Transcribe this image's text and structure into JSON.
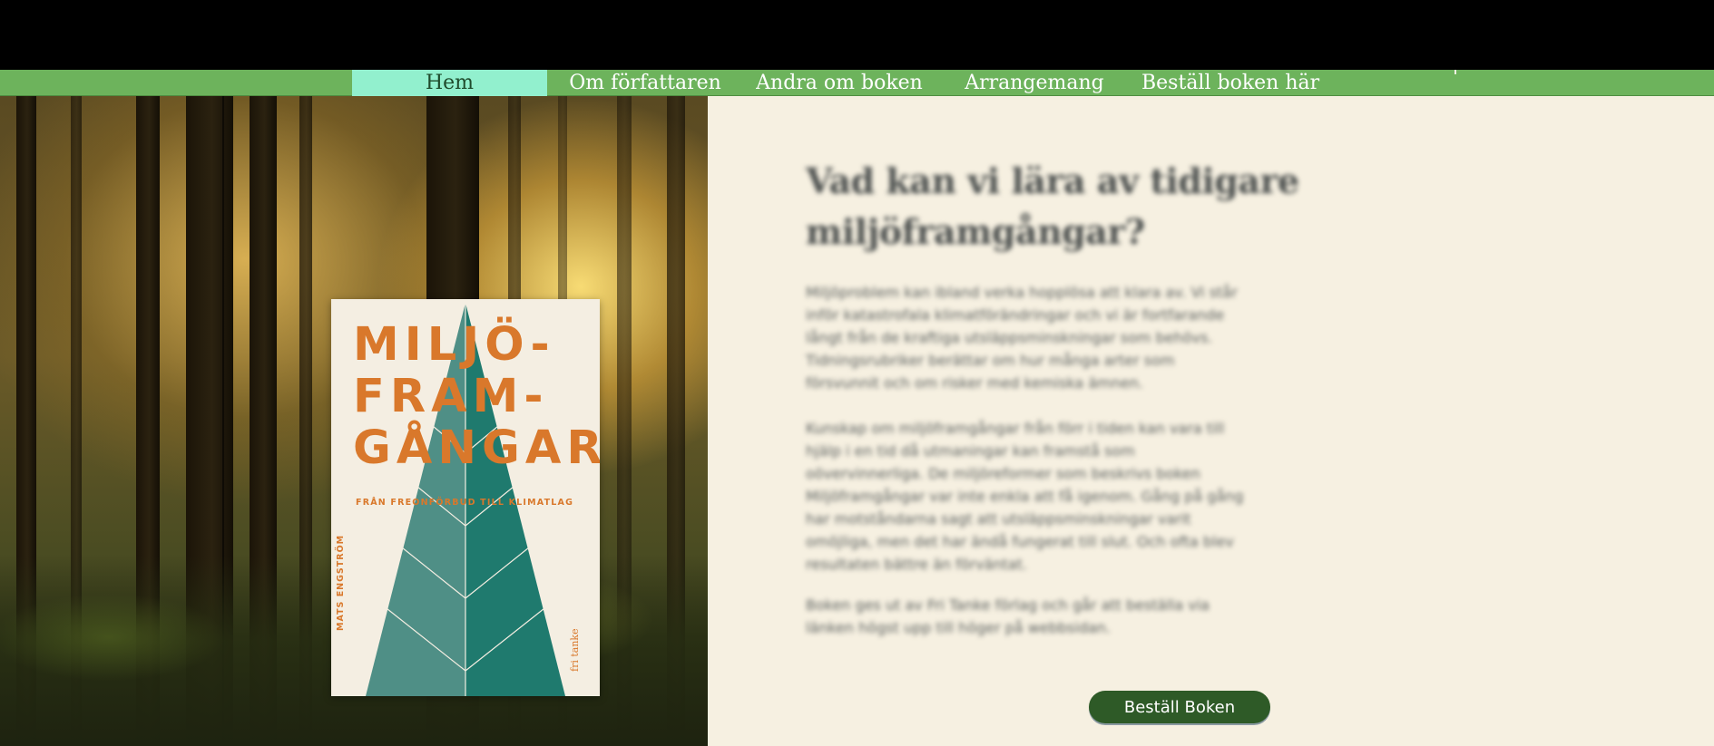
{
  "nav": {
    "items": [
      {
        "label": "Hem",
        "active": true
      },
      {
        "label": "Om författaren",
        "active": false
      },
      {
        "label": "Andra om boken",
        "active": false
      },
      {
        "label": "Arrangemang",
        "active": false
      },
      {
        "label": "Beställ boken här",
        "active": false
      }
    ]
  },
  "book": {
    "title_lines": [
      "MILJÖ-",
      "FRAM-",
      "GÅNGAR"
    ],
    "subtitle": "FRÅN FREONFÖRBUD TILL KLIMATLAG",
    "author": "MATS ENGSTRÖM",
    "publisher": "fri tanke"
  },
  "main": {
    "heading": "Vad kan vi lära av tidigare miljöframgångar?",
    "paragraphs": [
      "Miljöproblem kan ibland verka hopplösa att klara av. Vi står inför katastrofala klimatförändringar och vi är fortfarande långt från de kraftiga utsläppsminskningar som behövs. Tidningsrubriker berättar om hur många arter som försvunnit och om risker med kemiska ämnen.",
      "Kunskap om miljöframgångar från förr i tiden kan vara till hjälp i en tid då utmaningar kan framstå som oövervinnerliga. De miljöreformer som beskrivs boken Miljöframgångar var inte enkla att få igenom. Gång på gång har motståndarna sagt att utsläppsminskningar varit omöjliga, men det har ändå fungerat till slut. Och ofta blev resultaten bättre än förväntat.",
      "Boken ges ut av Fri Tanke förlag och går att beställa via länken högst upp till höger på webbsidan."
    ],
    "order_button": "Beställ Boken"
  },
  "colors": {
    "nav_bg": "#6db35c",
    "nav_active_bg": "#92f0ce",
    "content_bg": "#f6f0e1",
    "button_bg": "#2e5a27",
    "book_accent": "#d9782b",
    "tree_teal": "#4f8f86",
    "tree_dark_teal": "#1f7a6e"
  }
}
